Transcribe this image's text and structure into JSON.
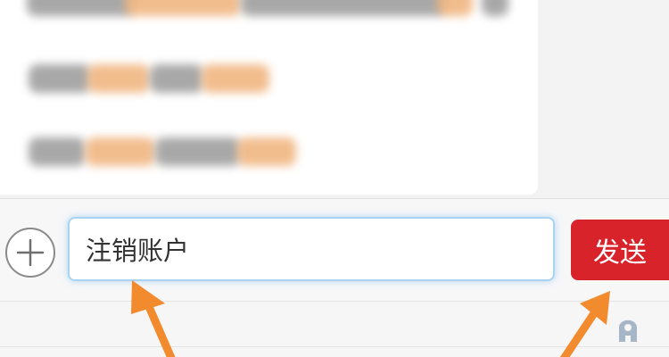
{
  "chat": {
    "message_blurred": true
  },
  "composer": {
    "plus_icon": "plus-circle-icon",
    "input_value": "注销账户",
    "send_label": "发送"
  },
  "footer": {
    "keyboard_icon": "input-method-icon"
  },
  "annotation": {
    "arrow_color": "#f28a2e"
  },
  "colors": {
    "send_button": "#d9232b",
    "input_border": "#a9d3f2",
    "background": "#f3f3f4"
  }
}
